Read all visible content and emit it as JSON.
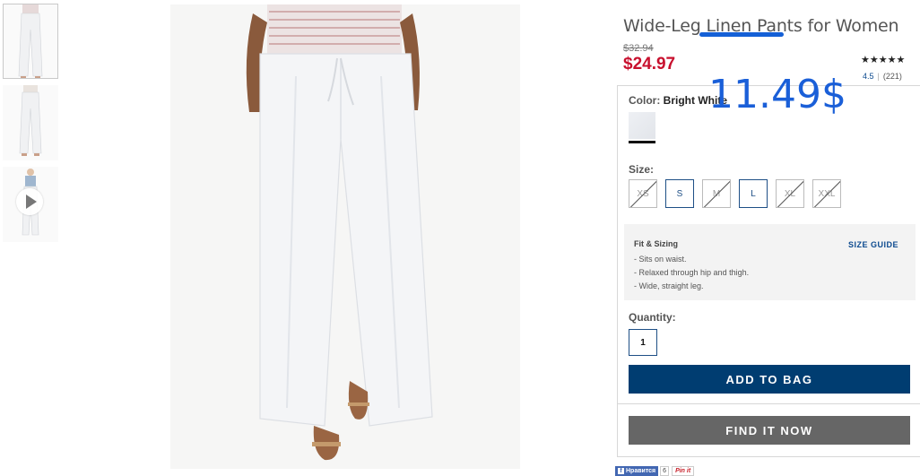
{
  "product": {
    "title": "Wide-Leg Linen Pants for Women",
    "old_price": "$32.94",
    "sale_price": "$24.97",
    "annotation_price": "11.49$",
    "rating": {
      "stars_display": "★★★★★",
      "value": "4.5",
      "count": "(221)"
    }
  },
  "thumbnails": [
    {
      "name": "front view"
    },
    {
      "name": "back view"
    },
    {
      "name": "video",
      "has_play": true
    }
  ],
  "color": {
    "label": "Color:",
    "value": "Bright White",
    "swatch_color": "#e8eaee"
  },
  "size": {
    "label": "Size:",
    "options": [
      {
        "label": "XS",
        "available": false
      },
      {
        "label": "S",
        "available": true
      },
      {
        "label": "M",
        "available": false
      },
      {
        "label": "L",
        "available": true
      },
      {
        "label": "XL",
        "available": false
      },
      {
        "label": "XXL",
        "available": false
      }
    ]
  },
  "fit": {
    "title": "Fit & Sizing",
    "size_guide": "SIZE GUIDE",
    "items": [
      "- Sits on waist.",
      "- Relaxed through hip and thigh.",
      "- Wide, straight leg."
    ]
  },
  "quantity": {
    "label": "Quantity:",
    "value": "1"
  },
  "buttons": {
    "add_to_bag": "ADD TO BAG",
    "find_it_now": "FIND IT NOW"
  },
  "social": {
    "fb_like": "Нравится",
    "fb_count": "6",
    "pin": "Pin it"
  },
  "colors": {
    "sale_red": "#c8102e",
    "primary_blue": "#003d71",
    "secondary_gray": "#666666",
    "annotation_blue": "#1a5fd8"
  }
}
